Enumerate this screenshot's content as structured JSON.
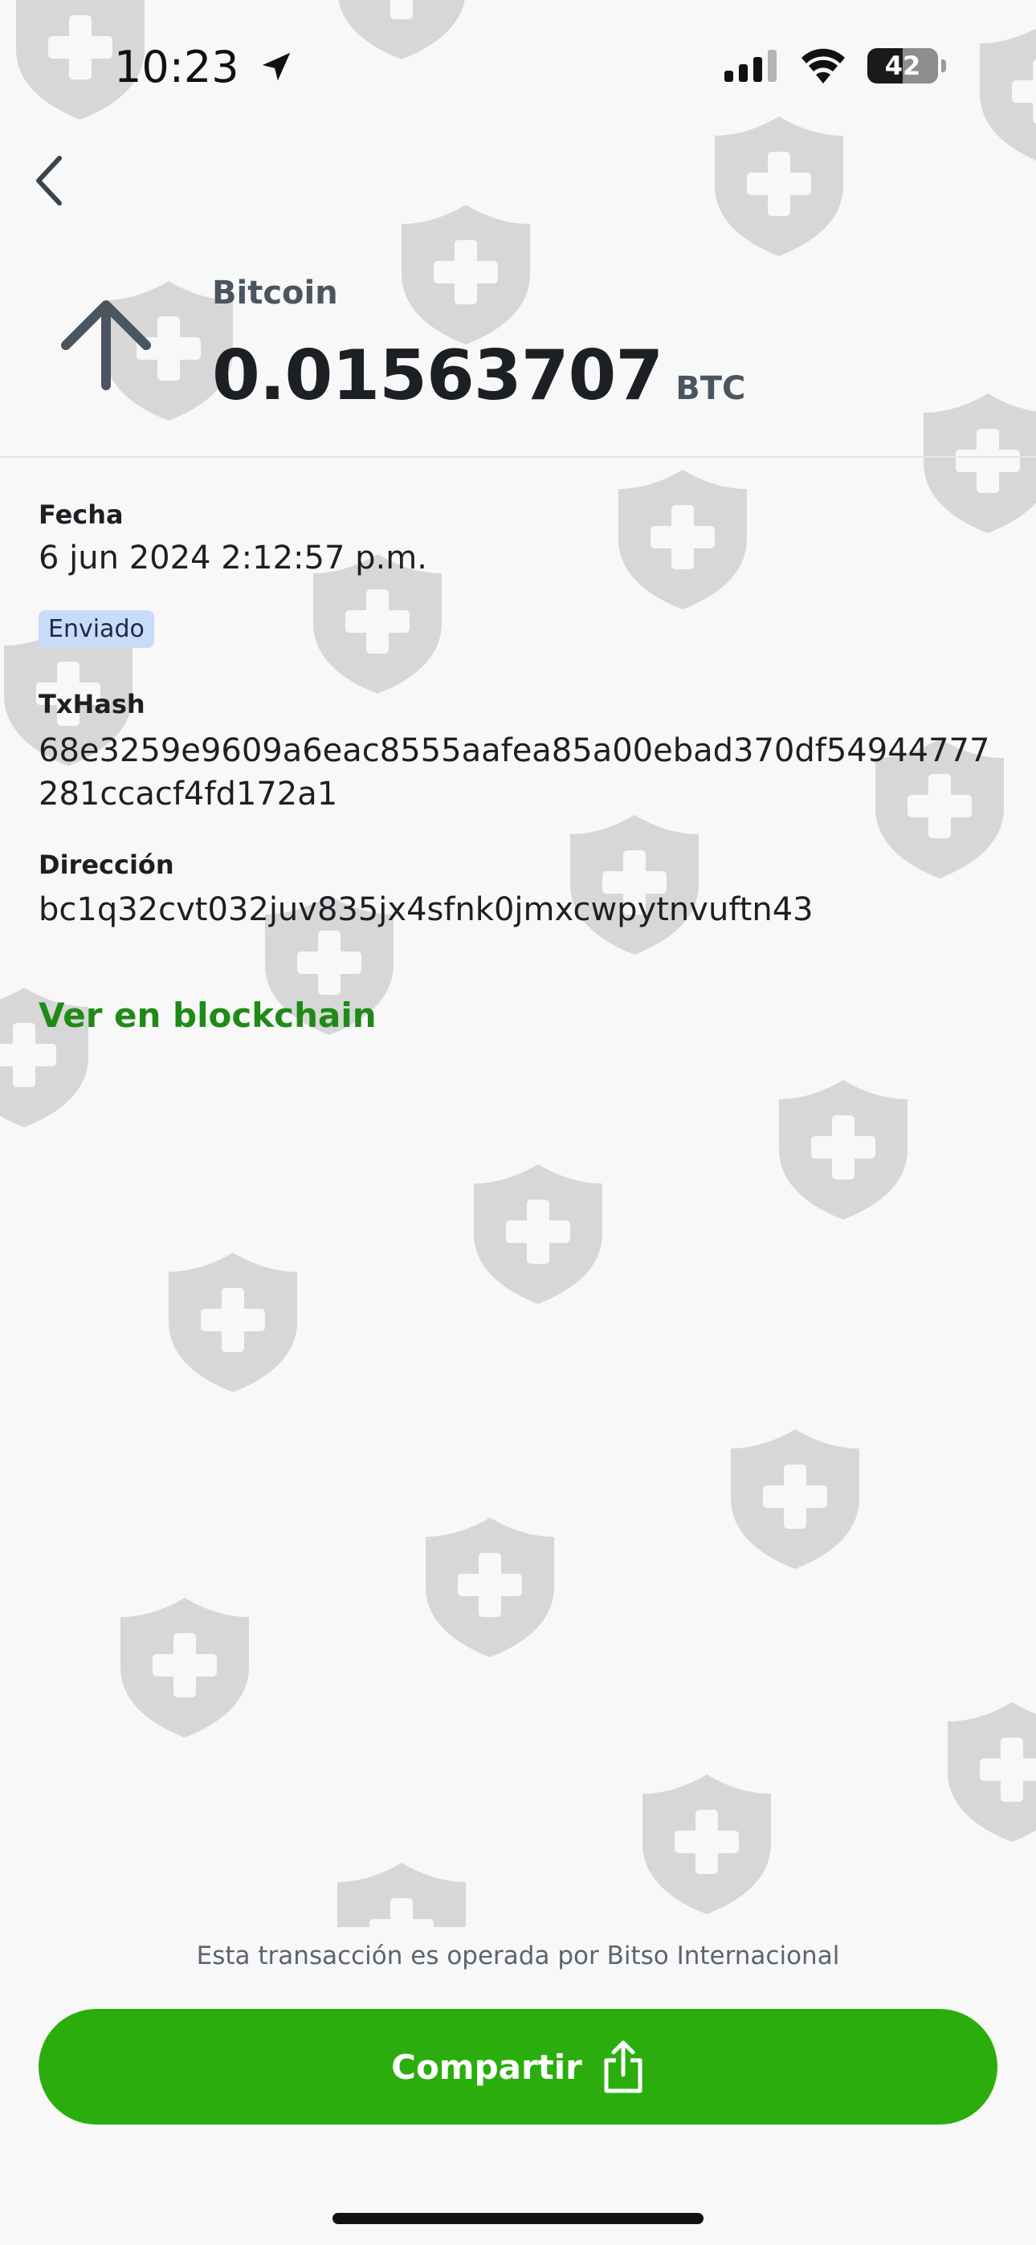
{
  "status_bar": {
    "time": "10:23",
    "battery": "42",
    "icons": [
      "location-arrow-icon",
      "cellular-signal-icon",
      "wifi-icon",
      "battery-icon"
    ]
  },
  "header": {
    "back_icon": "chevron-left-icon",
    "direction_icon": "arrow-up-icon",
    "asset_name": "Bitcoin",
    "amount": "0.01563707",
    "currency": "BTC"
  },
  "details": {
    "date_label": "Fecha",
    "date_value": "6 jun 2024 2:12:57 p.m.",
    "status_badge": "Enviado",
    "txhash_label": "TxHash",
    "txhash_value": "68e3259e9609a6eac8555aafea85a00ebad370df54944777281ccacf4fd172a1",
    "address_label": "Dirección",
    "address_value": "bc1q32cvt032juv835jx4sfnk0jmxcwpytnvuftn43",
    "blockchain_link": "Ver en blockchain"
  },
  "footer": {
    "note": "Esta transacción es operada por Bitso Internacional",
    "share_label": "Compartir",
    "share_icon": "share-icon"
  },
  "colors": {
    "background": "#f8f8f8",
    "primary_green": "#2bae0d",
    "link_green": "#1f8a16",
    "badge_blue": "#c8dcfa",
    "watermark_gray": "#d7d7d7"
  }
}
